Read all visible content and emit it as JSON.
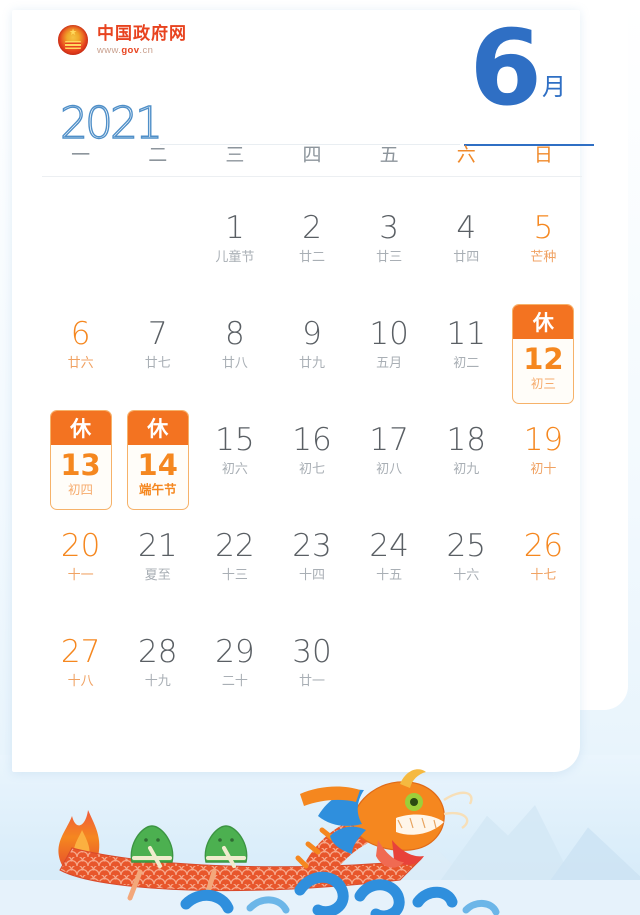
{
  "brand": {
    "emblem_icon": "national-emblem-icon",
    "title": "中国政府网",
    "url_prefix": "www.",
    "url_mid": "gov",
    "url_suffix": ".cn"
  },
  "header": {
    "year": "2021",
    "month_number": "6",
    "month_label": "月"
  },
  "weekdays": [
    {
      "label": "一",
      "weekend": false
    },
    {
      "label": "二",
      "weekend": false
    },
    {
      "label": "三",
      "weekend": false
    },
    {
      "label": "四",
      "weekend": false
    },
    {
      "label": "五",
      "weekend": false
    },
    {
      "label": "六",
      "weekend": true
    },
    {
      "label": "日",
      "weekend": true
    }
  ],
  "colors": {
    "accent_blue": "#2f6fc4",
    "accent_orange": "#f5871f",
    "badge_orange": "#f37321",
    "weekday_gray": "#8d959c",
    "day_gray": "#5a5f64",
    "lunar_gray": "#a9afb5"
  },
  "rest_label": "休",
  "days": [
    {
      "blank": true
    },
    {
      "blank": true
    },
    {
      "num": "1",
      "sub": "儿童节",
      "weekend": false,
      "rest": false
    },
    {
      "num": "2",
      "sub": "廿二",
      "weekend": false,
      "rest": false
    },
    {
      "num": "3",
      "sub": "廿三",
      "weekend": false,
      "rest": false
    },
    {
      "num": "4",
      "sub": "廿四",
      "weekend": false,
      "rest": false
    },
    {
      "num": "5",
      "sub": "芒种",
      "weekend": true,
      "rest": false
    },
    {
      "num": "6",
      "sub": "廿六",
      "weekend": true,
      "rest": false
    },
    {
      "num": "7",
      "sub": "廿七",
      "weekend": false,
      "rest": false
    },
    {
      "num": "8",
      "sub": "廿八",
      "weekend": false,
      "rest": false
    },
    {
      "num": "9",
      "sub": "廿九",
      "weekend": false,
      "rest": false
    },
    {
      "num": "10",
      "sub": "五月",
      "weekend": false,
      "rest": false
    },
    {
      "num": "11",
      "sub": "初二",
      "weekend": false,
      "rest": false
    },
    {
      "num": "12",
      "sub": "初三",
      "weekend": true,
      "rest": true,
      "sub_pale": true
    },
    {
      "num": "13",
      "sub": "初四",
      "weekend": true,
      "rest": true,
      "sub_pale": true
    },
    {
      "num": "14",
      "sub": "端午节",
      "weekend": false,
      "rest": true,
      "sub_pale": false
    },
    {
      "num": "15",
      "sub": "初六",
      "weekend": false,
      "rest": false
    },
    {
      "num": "16",
      "sub": "初七",
      "weekend": false,
      "rest": false
    },
    {
      "num": "17",
      "sub": "初八",
      "weekend": false,
      "rest": false
    },
    {
      "num": "18",
      "sub": "初九",
      "weekend": false,
      "rest": false
    },
    {
      "num": "19",
      "sub": "初十",
      "weekend": true,
      "rest": false
    },
    {
      "num": "20",
      "sub": "十一",
      "weekend": true,
      "rest": false
    },
    {
      "num": "21",
      "sub": "夏至",
      "weekend": false,
      "rest": false
    },
    {
      "num": "22",
      "sub": "十三",
      "weekend": false,
      "rest": false
    },
    {
      "num": "23",
      "sub": "十四",
      "weekend": false,
      "rest": false
    },
    {
      "num": "24",
      "sub": "十五",
      "weekend": false,
      "rest": false
    },
    {
      "num": "25",
      "sub": "十六",
      "weekend": false,
      "rest": false
    },
    {
      "num": "26",
      "sub": "十七",
      "weekend": true,
      "rest": false
    },
    {
      "num": "27",
      "sub": "十八",
      "weekend": true,
      "rest": false
    },
    {
      "num": "28",
      "sub": "十九",
      "weekend": false,
      "rest": false
    },
    {
      "num": "29",
      "sub": "二十",
      "weekend": false,
      "rest": false
    },
    {
      "num": "30",
      "sub": "廿一",
      "weekend": false,
      "rest": false
    },
    {
      "blank": true
    },
    {
      "blank": true
    },
    {
      "blank": true
    },
    {
      "blank": true
    }
  ],
  "illustration": {
    "name": "dragon-boat-zongzi-illustration",
    "elements": [
      "dragon-head",
      "dragon-boat-hull",
      "zongzi-paddler",
      "zongzi-paddler",
      "flame-tail",
      "blue-waves",
      "mountains"
    ]
  }
}
